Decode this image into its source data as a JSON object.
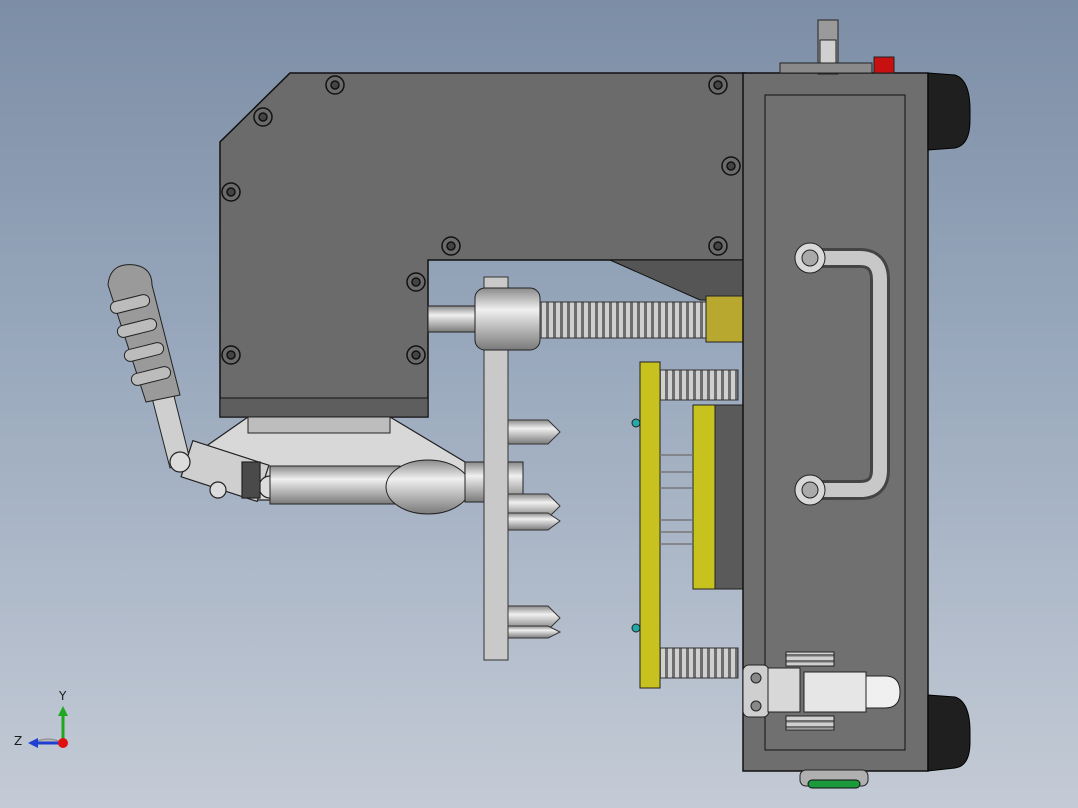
{
  "view": {
    "background_top": "#7c8ea6",
    "background_bottom": "#c4cbd6"
  },
  "model": {
    "body_color": "#6b6b6b",
    "edge_color": "#111111",
    "plate_color": "#c9c9c9",
    "pcb_color": "#c8c21e",
    "spring_color": "#b8b8b8",
    "handle_color": "#b0b0b0",
    "foot_color": "#1f1f1f",
    "indicator_red": "#c81010",
    "indicator_green": "#1a9a3a"
  },
  "triad": {
    "y_label": "Y",
    "z_label": "Z",
    "y_color": "#1fa81f",
    "z_color": "#1f3fd0",
    "x_color": "#e01010"
  }
}
